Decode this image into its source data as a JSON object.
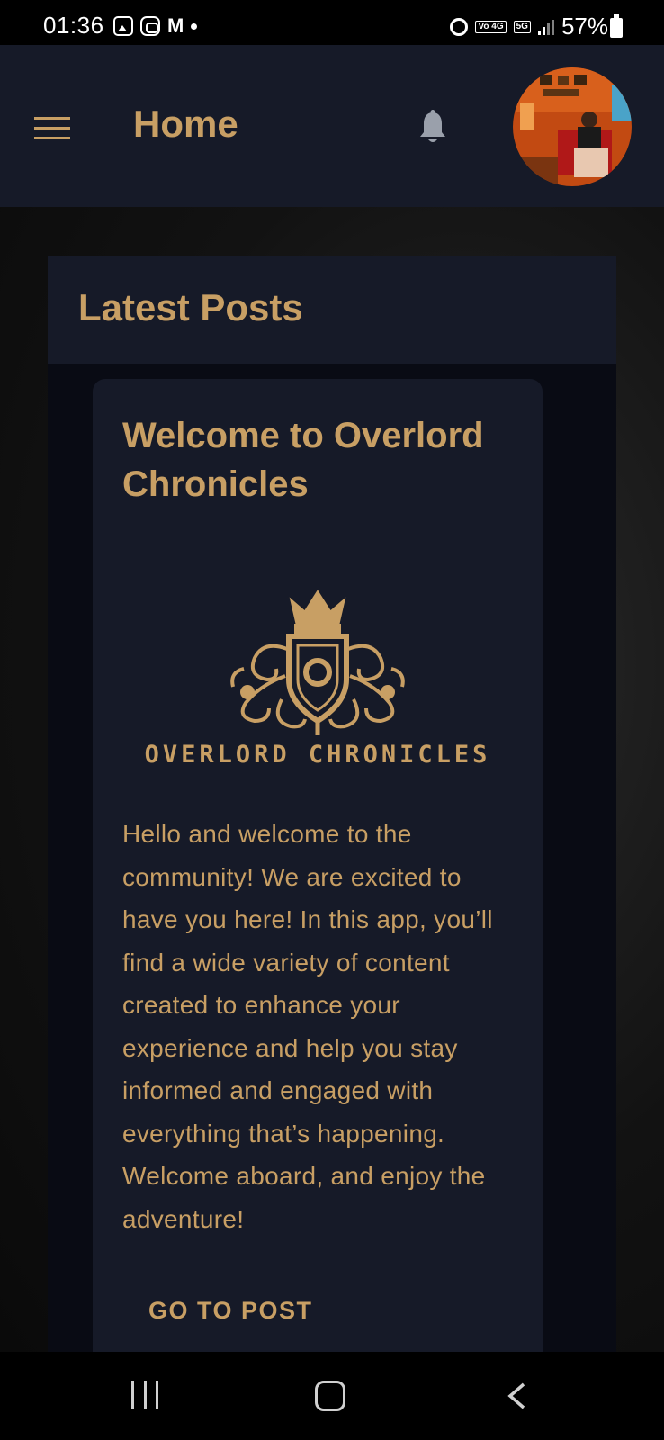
{
  "status_bar": {
    "time": "01:36",
    "notification_icons": [
      "gallery-icon",
      "bot-icon",
      "gmail-icon"
    ],
    "mail_glyph": "M",
    "network_tag_1": "Vo 4G",
    "network_tag_2": "5G",
    "battery": "57%"
  },
  "app_bar": {
    "title": "Home",
    "menu_icon": "hamburger-menu-icon",
    "notification_icon": "bell-icon",
    "avatar_alt": "profile photo"
  },
  "feed": {
    "section_title": "Latest Posts",
    "posts": [
      {
        "title": "Welcome to Overlord Chronicles",
        "logo_text": "OVERLORD CHRONICLES",
        "body": "Hello and welcome to the community! We are excited to have you here! In this app, you’ll find a wide variety of content created to enhance your experience and help you stay informed and engaged with everything that’s happening. Welcome aboard, and enjoy the adventure!",
        "action_label": "GO TO POST"
      }
    ]
  },
  "nav_bar": {
    "recent_icon": "recent-apps-icon",
    "home_icon": "home-icon",
    "back_icon": "back-icon"
  },
  "colors": {
    "accent": "#c89f64",
    "app_bar_bg": "#161a28",
    "card_bg": "#090b14"
  }
}
